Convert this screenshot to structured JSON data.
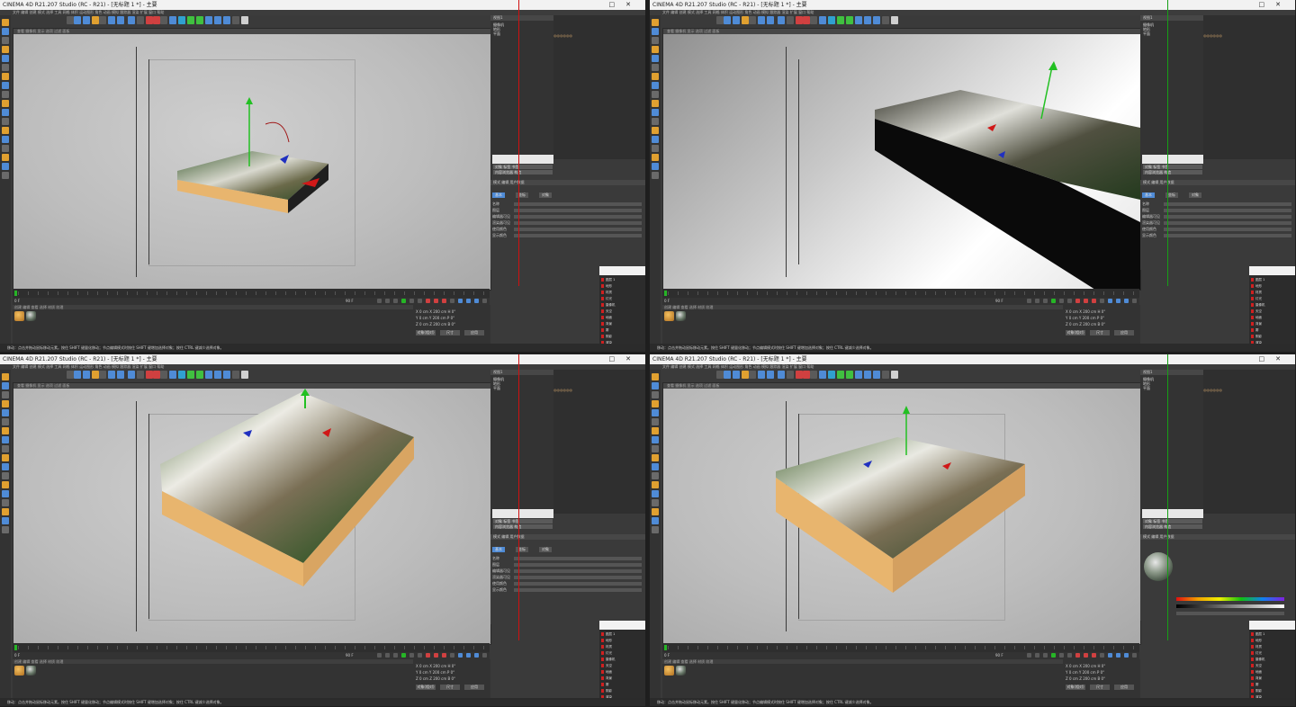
{
  "windows": [
    {
      "id": "q1",
      "title": "CINEMA 4D R21.207 Studio (RC - R21) - [无标题 1 *] - 主要",
      "view_label": "视图1",
      "viewport_header": "查看 摄像机 显示 选项 过滤 面板",
      "menu": "文件 编辑 创建 模式 选择 工具 网格 体积 运动图形 角色 动画 模拟 跟踪器 渲染 扩展 窗口 帮助",
      "objects": [
        "摄像机",
        "地形",
        "平面"
      ],
      "tag_text": "◎◎◎◎◎◎",
      "layout_buttons": [
        "对象 标签 书签",
        "内容浏览器 构造"
      ],
      "attr_header": "模式 编辑 用户数据",
      "attr_tabs": [
        "基本",
        "坐标",
        "对象"
      ],
      "attr_rows": [
        "名称",
        "图层",
        "编辑器可见",
        "渲染器可见",
        "使用颜色",
        "显示颜色"
      ],
      "frame": "0 F",
      "frame_end": "90 F",
      "material_menu": "创建 编辑 查看 选择 材质 纹理",
      "coord_rows": [
        "X 0 cm   X 200 cm   H 0°",
        "Y 0 cm   Y 200 cm   P 0°",
        "Z 0 cm   Z 200 cm   B 0°"
      ],
      "coord_buttons": [
        "对象(相对)",
        "尺寸",
        "应用"
      ],
      "status": "移动：点击并拖动鼠标移动元素。按住 SHIFT 键量化移动；节点编辑模式时按住 SHIFT 键增加选择对象；按住 CTRL 键减少选择对象。",
      "layers": [
        "图层 1",
        "地形",
        "材质",
        "灯光",
        "摄像机",
        "天空",
        "地面",
        "背景",
        "雾",
        "阴影",
        "渲染"
      ],
      "render_view": false,
      "guide_line": "red",
      "shader_view": false
    },
    {
      "id": "q2",
      "title": "CINEMA 4D R21.207 Studio (RC - R21) - [无标题 1 *] - 主要",
      "view_label": "视图1",
      "viewport_header": "查看 摄像机 显示 选项 过滤 面板",
      "menu": "文件 编辑 创建 模式 选择 工具 网格 体积 运动图形 角色 动画 模拟 跟踪器 渲染 扩展 窗口 帮助",
      "objects": [
        "摄像机",
        "地形",
        "平面"
      ],
      "tag_text": "◎◎◎◎◎◎",
      "layout_buttons": [
        "对象 标签 书签",
        "内容浏览器 构造"
      ],
      "attr_header": "模式 编辑 用户数据",
      "attr_tabs": [
        "基本",
        "坐标",
        "对象"
      ],
      "attr_rows": [
        "名称",
        "图层",
        "编辑器可见",
        "渲染器可见",
        "使用颜色",
        "显示颜色"
      ],
      "frame": "0 F",
      "frame_end": "90 F",
      "material_menu": "创建 编辑 查看 选择 材质 纹理",
      "coord_rows": [
        "X 0 cm   X 200 cm   H 0°",
        "Y 0 cm   Y 200 cm   P 0°",
        "Z 0 cm   Z 200 cm   B 0°"
      ],
      "coord_buttons": [
        "对象(相对)",
        "尺寸",
        "应用"
      ],
      "status": "移动：点击并拖动鼠标移动元素。按住 SHIFT 键量化移动；节点编辑模式时按住 SHIFT 键增加选择对象；按住 CTRL 键减少选择对象。",
      "layers": [
        "图层 1",
        "地形",
        "材质",
        "灯光",
        "摄像机",
        "天空",
        "地面",
        "背景",
        "雾",
        "阴影",
        "渲染"
      ],
      "render_view": true,
      "guide_line": "green",
      "shader_view": false
    },
    {
      "id": "q3",
      "title": "CINEMA 4D R21.207 Studio (RC - R21) - [无标题 1 *] - 主要",
      "view_label": "视图1",
      "viewport_header": "查看 摄像机 显示 选项 过滤 面板",
      "menu": "文件 编辑 创建 模式 选择 工具 网格 体积 运动图形 角色 动画 模拟 跟踪器 渲染 扩展 窗口 帮助",
      "objects": [
        "摄像机",
        "地形",
        "平面"
      ],
      "tag_text": "◎◎◎◎◎◎",
      "layout_buttons": [
        "对象 标签 书签",
        "内容浏览器 构造"
      ],
      "attr_header": "模式 编辑 用户数据",
      "attr_tabs": [
        "基本",
        "坐标",
        "对象"
      ],
      "attr_rows": [
        "名称",
        "图层",
        "编辑器可见",
        "渲染器可见",
        "使用颜色",
        "显示颜色"
      ],
      "frame": "0 F",
      "frame_end": "90 F",
      "material_menu": "创建 编辑 查看 选择 材质 纹理",
      "coord_rows": [
        "X 0 cm   X 200 cm   H 0°",
        "Y 0 cm   Y 200 cm   P 0°",
        "Z 0 cm   Z 200 cm   B 0°"
      ],
      "coord_buttons": [
        "对象(相对)",
        "尺寸",
        "应用"
      ],
      "status": "移动：点击并拖动鼠标移动元素。按住 SHIFT 键量化移动；节点编辑模式时按住 SHIFT 键增加选择对象；按住 CTRL 键减少选择对象。",
      "layers": [
        "图层 1",
        "地形",
        "材质",
        "灯光",
        "摄像机",
        "天空",
        "地面",
        "背景",
        "雾",
        "阴影",
        "渲染"
      ],
      "render_view": false,
      "guide_line": "red",
      "shader_view": false
    },
    {
      "id": "q4",
      "title": "CINEMA 4D R21.207 Studio (RC - R21) - [无标题 1 *] - 主要",
      "view_label": "视图1",
      "viewport_header": "查看 摄像机 显示 选项 过滤 面板",
      "menu": "文件 编辑 创建 模式 选择 工具 网格 体积 运动图形 角色 动画 模拟 跟踪器 渲染 扩展 窗口 帮助",
      "objects": [
        "摄像机",
        "地形",
        "平面"
      ],
      "tag_text": "◎◎◎◎◎◎",
      "layout_buttons": [
        "对象 标签 书签",
        "内容浏览器 构造"
      ],
      "attr_header": "模式 编辑 用户数据",
      "attr_tabs": [
        "基本",
        "坐标",
        "对象"
      ],
      "attr_rows": [
        "名称",
        "图层",
        "编辑器可见",
        "渲染器可见",
        "使用颜色",
        "显示颜色"
      ],
      "frame": "0 F",
      "frame_end": "90 F",
      "material_menu": "创建 编辑 查看 选择 材质 纹理",
      "coord_rows": [
        "X 0 cm   X 200 cm   H 0°",
        "Y 0 cm   Y 200 cm   P 0°",
        "Z 0 cm   Z 200 cm   B 0°"
      ],
      "coord_buttons": [
        "对象(相对)",
        "尺寸",
        "应用"
      ],
      "status": "移动：点击并拖动鼠标移动元素。按住 SHIFT 键量化移动；节点编辑模式时按住 SHIFT 键增加选择对象；按住 CTRL 键减少选择对象。",
      "layers": [
        "图层 1",
        "地形",
        "材质",
        "灯光",
        "摄像机",
        "天空",
        "地面",
        "背景",
        "雾",
        "阴影",
        "渲染"
      ],
      "render_view": false,
      "guide_line": "green",
      "shader_view": true
    }
  ],
  "icons": {
    "close": "close-icon",
    "minimize": "minimize-icon",
    "play": "play-icon",
    "move": "move-icon",
    "rotate": "rotate-icon",
    "scale": "scale-icon"
  },
  "colors": {
    "accent": "#4f8bd6",
    "guide_red": "#d01010",
    "guide_green": "#16a016",
    "terrain_side": "#e8b56e",
    "gradient": [
      "#e01010",
      "#f0a000",
      "#f0f000",
      "#10c010",
      "#1080f0",
      "#8020e0"
    ]
  }
}
